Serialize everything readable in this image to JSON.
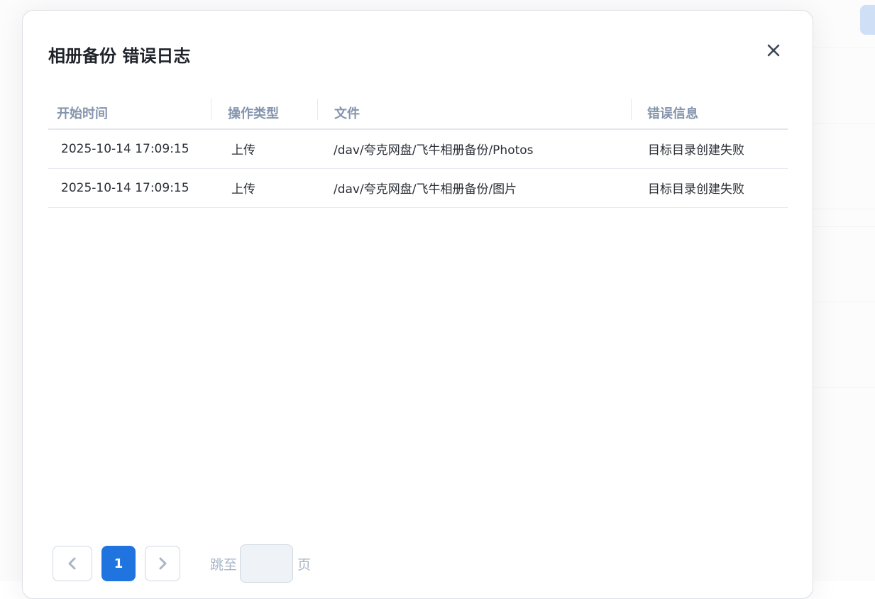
{
  "dialog": {
    "title": "相册备份 错误日志",
    "close_icon": "close-icon"
  },
  "table": {
    "headers": [
      "开始时间",
      "操作类型",
      "文件",
      "错误信息"
    ],
    "rows": [
      {
        "time": "2025-10-14 17:09:15",
        "type": "上传",
        "file": "/dav/夸克网盘/飞牛相册备份/Photos",
        "error": "目标目录创建失败"
      },
      {
        "time": "2025-10-14 17:09:15",
        "type": "上传",
        "file": "/dav/夸克网盘/飞牛相册备份/图片",
        "error": "目标目录创建失败"
      }
    ]
  },
  "pagination": {
    "current_page": "1",
    "jump_label": "跳至",
    "page_suffix": "页",
    "jump_value": ""
  },
  "colors": {
    "primary": "#1f74e0"
  }
}
